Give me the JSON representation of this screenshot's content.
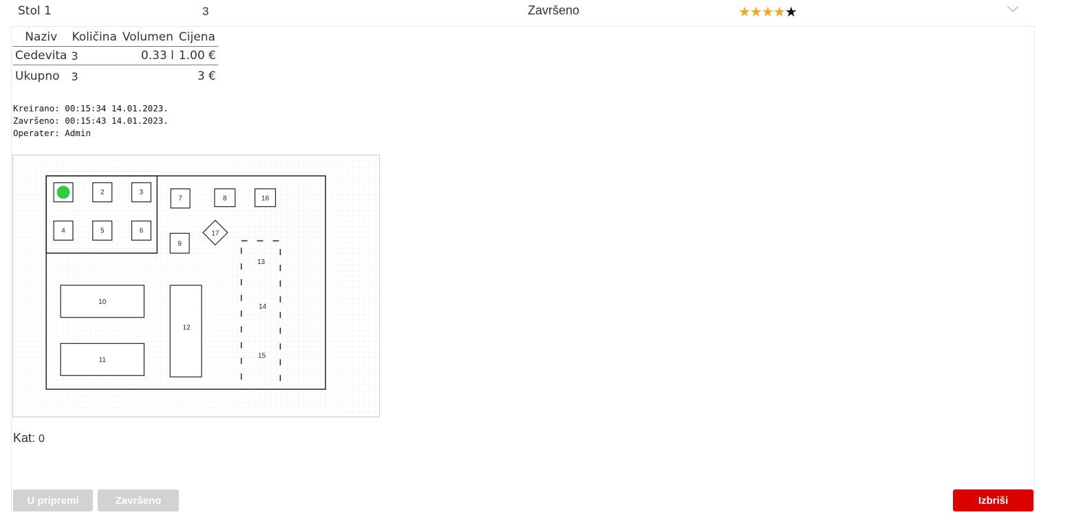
{
  "header": {
    "table_label": "Stol 1",
    "count": "3",
    "status": "Završeno",
    "rating": 4,
    "rating_max": 5,
    "stars_on": "★★★★",
    "stars_off": "★",
    "expand_icon": "chevron-down-icon"
  },
  "items_table": {
    "columns": [
      "Naziv",
      "Količina",
      "Volumen",
      "Cijena"
    ],
    "rows": [
      {
        "name": "Cedevita",
        "quantity": "3",
        "volume": "0.33 l",
        "price": "1.00 €"
      }
    ],
    "total": {
      "label": "Ukupno",
      "quantity": "3",
      "price": "3 €"
    }
  },
  "meta": {
    "created": "Kreirano: 00:15:34 14.01.2023.",
    "finished": "Završeno: 00:15:43 14.01.2023.",
    "operator": "Operater: Admin"
  },
  "floor_plan": {
    "tables": [
      "2",
      "3",
      "4",
      "5",
      "6",
      "7",
      "8",
      "16",
      "9",
      "17",
      "10",
      "12",
      "11",
      "13",
      "14",
      "15"
    ],
    "active_marker_color": "#2ecc40"
  },
  "floor": {
    "label": "Kat:",
    "value": "0"
  },
  "buttons": {
    "in_prep": "U pripremi",
    "done": "Završeno",
    "delete": "Izbriši"
  },
  "colors": {
    "accent_delete": "#dd0000",
    "star": "#f5a623",
    "disabled": "#d2d2d2"
  }
}
